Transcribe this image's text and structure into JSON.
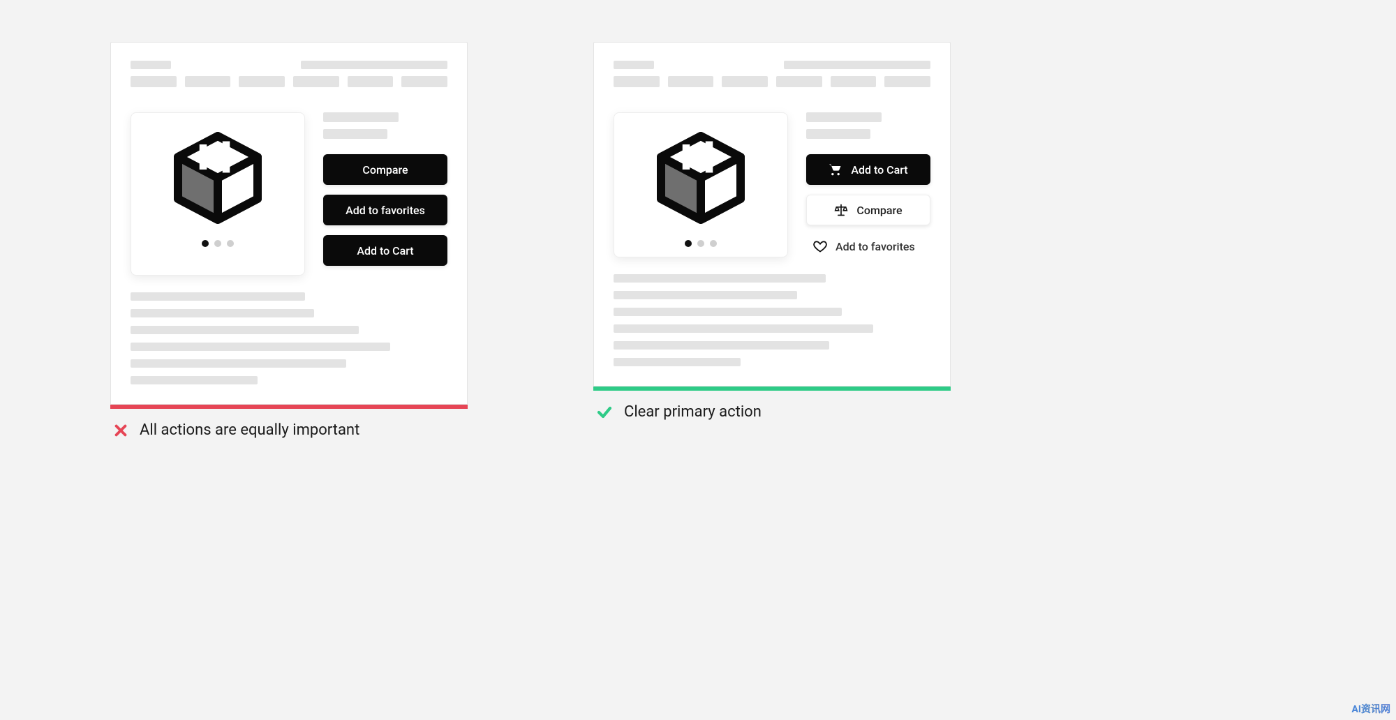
{
  "left": {
    "buttons": {
      "compare": "Compare",
      "favorites": "Add to favorites",
      "cart": "Add to Cart"
    },
    "caption": "All actions are equally important"
  },
  "right": {
    "buttons": {
      "cart": "Add to Cart",
      "compare": "Compare",
      "favorites": "Add to favorites"
    },
    "caption": "Clear primary action"
  },
  "watermark": "AI资讯网"
}
